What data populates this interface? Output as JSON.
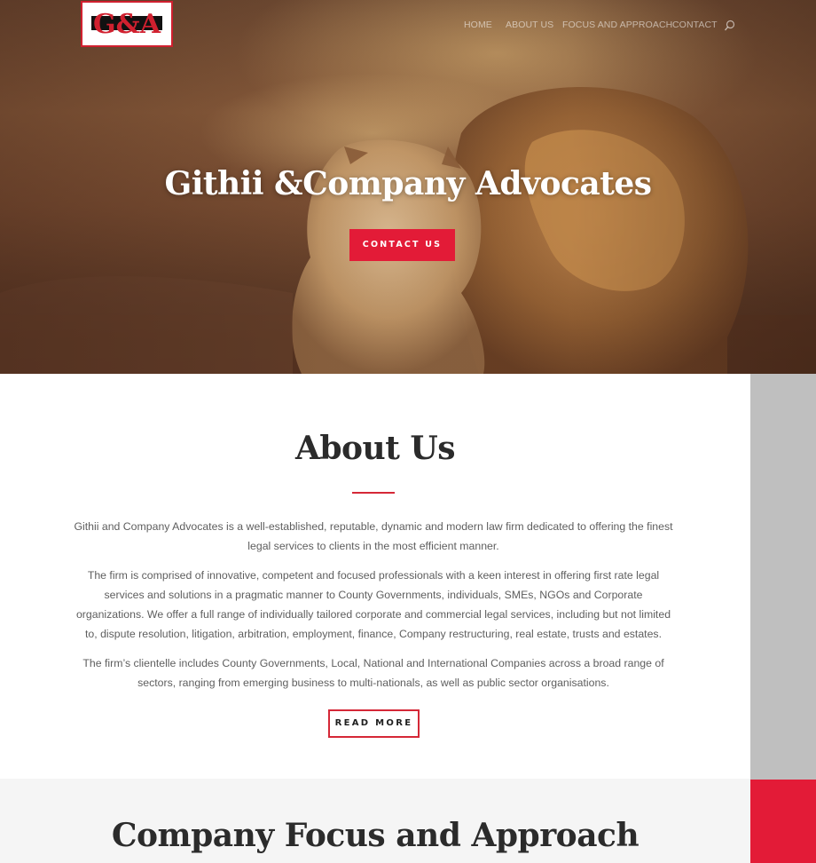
{
  "brand": {
    "logo_text": "G&A",
    "accent_color": "#e31b37"
  },
  "nav": {
    "items": [
      "HOME",
      "ABOUT US",
      "FOCUS AND APPROACH",
      "CONTACT"
    ],
    "search_icon": "search-icon"
  },
  "hero": {
    "title": "Githii &Company Advocates",
    "button_label": "CONTACT US"
  },
  "about": {
    "title": "About Us",
    "paragraphs": [
      "Githii and Company Advocates is a well-established, reputable, dynamic and modern law firm dedicated to offering the finest legal services to clients in the most efficient manner.",
      "The firm is comprised of innovative, competent and focused professionals with a keen interest in offering first rate legal services and solutions in a pragmatic manner to County Governments, individuals, SMEs, NGOs and Corporate organizations. We offer a full range of individually tailored corporate and commercial legal services, including but not limited to, dispute resolution, litigation, arbitration, employment, finance, Company restructuring, real estate, trusts and estates.",
      "The firm’s clientelle includes County Governments, Local, National and International Companies across a broad range of sectors, ranging from emerging business to multi-nationals, as well as public sector organisations."
    ],
    "button_label": "READ MORE"
  },
  "focus": {
    "title": "Company Focus and Approach"
  }
}
